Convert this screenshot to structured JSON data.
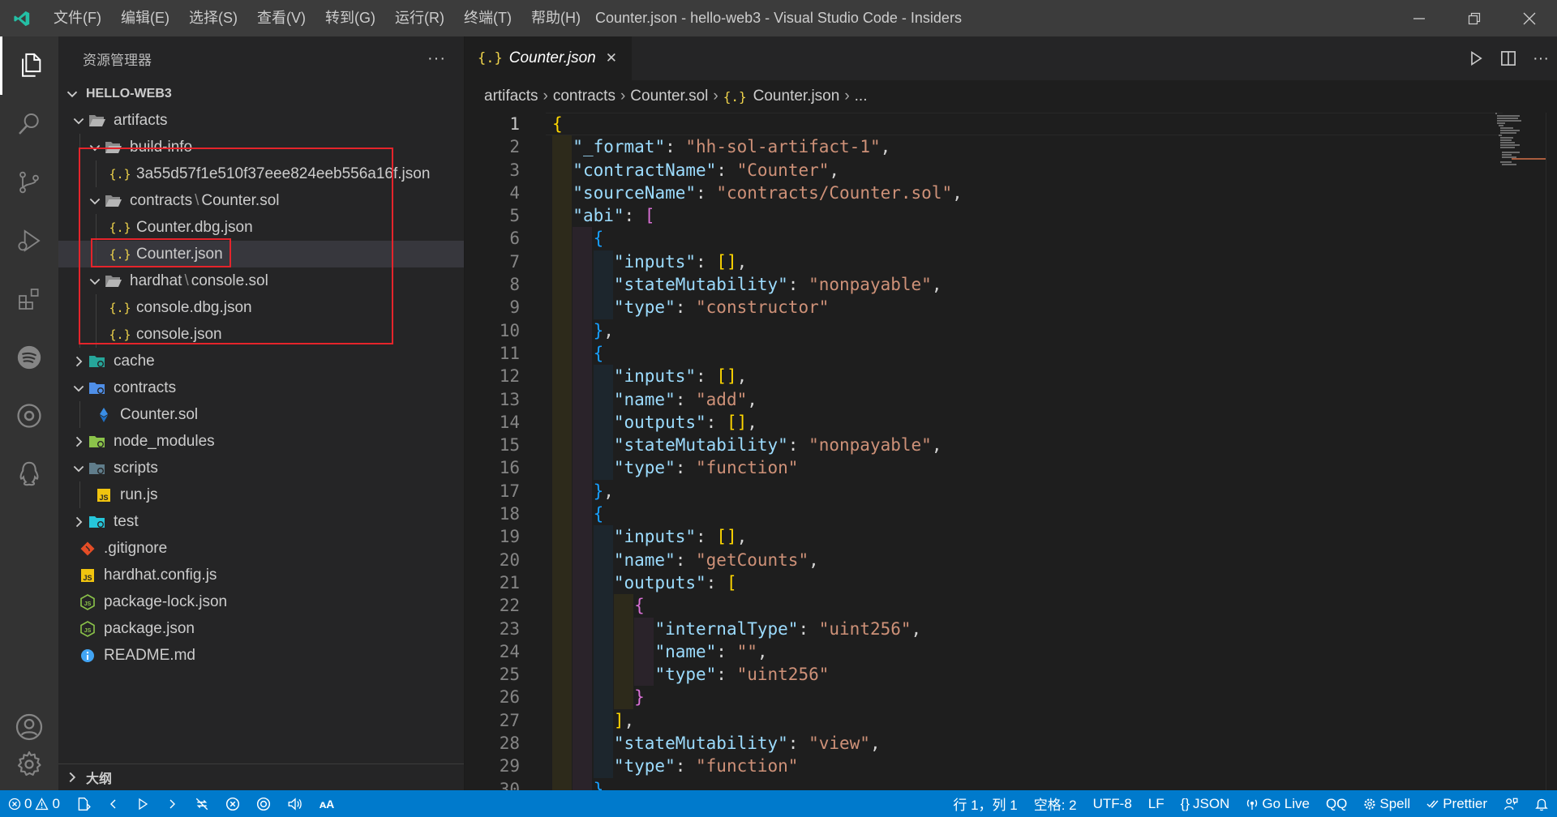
{
  "window": {
    "title": "Counter.json - hello-web3 - Visual Studio Code - Insiders",
    "menu": [
      "文件(F)",
      "编辑(E)",
      "选择(S)",
      "查看(V)",
      "转到(G)",
      "运行(R)",
      "终端(T)",
      "帮助(H)"
    ]
  },
  "activity_bar": {
    "items": [
      "explorer-icon",
      "search-icon",
      "source-control-icon",
      "run-debug-icon",
      "extensions-icon",
      "spotify-icon",
      "target-icon",
      "qq-penguin-icon"
    ],
    "bottom": [
      "account-icon",
      "settings-gear-icon"
    ]
  },
  "sidebar": {
    "title": "资源管理器",
    "more": "···",
    "section": "HELLO-WEB3",
    "outline": "大纲",
    "tree": [
      {
        "label": "artifacts",
        "depth": 0,
        "type": "folder-open",
        "icon": "folder-open-icon",
        "color": "#c09553"
      },
      {
        "label": "build-info",
        "depth": 1,
        "type": "folder-open",
        "icon": "folder-open-icon",
        "color": "#c09553"
      },
      {
        "label": "3a55d57f1e510f37eee824eeb556a16f.json",
        "depth": 2,
        "type": "file",
        "icon": "json-file-icon",
        "color": "#f1d54c"
      },
      {
        "label": "contracts",
        "label2": "Counter.sol",
        "depth": 1,
        "type": "folder-open",
        "icon": "folder-open-icon",
        "color": "#c09553"
      },
      {
        "label": "Counter.dbg.json",
        "depth": 2,
        "type": "file",
        "icon": "json-file-icon",
        "color": "#f1d54c"
      },
      {
        "label": "Counter.json",
        "depth": 2,
        "type": "file",
        "icon": "json-file-icon",
        "color": "#f1d54c",
        "selected": true
      },
      {
        "label": "hardhat",
        "label2": "console.sol",
        "depth": 1,
        "type": "folder-open",
        "icon": "folder-open-icon",
        "color": "#c09553"
      },
      {
        "label": "console.dbg.json",
        "depth": 2,
        "type": "file",
        "icon": "json-file-icon",
        "color": "#f1d54c"
      },
      {
        "label": "console.json",
        "depth": 2,
        "type": "file",
        "icon": "json-file-icon",
        "color": "#f1d54c"
      },
      {
        "label": "cache",
        "depth": 0,
        "type": "folder-closed",
        "icon": "cache-folder-icon",
        "color": "#26a69a"
      },
      {
        "label": "contracts",
        "depth": 0,
        "type": "folder-open",
        "icon": "contracts-folder-icon",
        "color": "#4f8fe8"
      },
      {
        "label": "Counter.sol",
        "depth": 1,
        "type": "file",
        "icon": "solidity-file-icon",
        "color": "#3a8ee6"
      },
      {
        "label": "node_modules",
        "depth": 0,
        "type": "folder-closed",
        "icon": "node-modules-folder-icon",
        "color": "#8bc34a"
      },
      {
        "label": "scripts",
        "depth": 0,
        "type": "folder-open",
        "icon": "scripts-folder-icon",
        "color": "#607d8b"
      },
      {
        "label": "run.js",
        "depth": 1,
        "type": "file",
        "icon": "js-file-icon",
        "color": "#f1c40f"
      },
      {
        "label": "test",
        "depth": 0,
        "type": "folder-closed",
        "icon": "test-folder-icon",
        "color": "#26c6da"
      },
      {
        "label": ".gitignore",
        "depth": 0,
        "type": "file",
        "icon": "git-icon",
        "color": "#e44d26"
      },
      {
        "label": "hardhat.config.js",
        "depth": 0,
        "type": "file",
        "icon": "js-file-icon",
        "color": "#f1c40f"
      },
      {
        "label": "package-lock.json",
        "depth": 0,
        "type": "file",
        "icon": "node-package-icon",
        "color": "#8bc34a"
      },
      {
        "label": "package.json",
        "depth": 0,
        "type": "file",
        "icon": "node-package-icon",
        "color": "#8bc34a"
      },
      {
        "label": "README.md",
        "depth": 0,
        "type": "file",
        "icon": "info-icon",
        "color": "#42a5f5"
      }
    ]
  },
  "editor": {
    "tab": {
      "label": "Counter.json",
      "close": "✕"
    },
    "breadcrumbs": [
      "artifacts",
      "contracts",
      "Counter.sol",
      "Counter.json",
      "..."
    ],
    "current_line": 1,
    "lines": [
      [
        [
          "{",
          "b1"
        ]
      ],
      [
        [
          "  ",
          ""
        ],
        [
          "\"_format\"",
          "k"
        ],
        [
          ": ",
          "p"
        ],
        [
          "\"hh-sol-artifact-1\"",
          "s"
        ],
        [
          ",",
          "p"
        ]
      ],
      [
        [
          "  ",
          ""
        ],
        [
          "\"contractName\"",
          "k"
        ],
        [
          ": ",
          "p"
        ],
        [
          "\"Counter\"",
          "s"
        ],
        [
          ",",
          "p"
        ]
      ],
      [
        [
          "  ",
          ""
        ],
        [
          "\"sourceName\"",
          "k"
        ],
        [
          ": ",
          "p"
        ],
        [
          "\"contracts/Counter.sol\"",
          "s"
        ],
        [
          ",",
          "p"
        ]
      ],
      [
        [
          "  ",
          ""
        ],
        [
          "\"abi\"",
          "k"
        ],
        [
          ": ",
          "p"
        ],
        [
          "[",
          "b2"
        ]
      ],
      [
        [
          "    ",
          ""
        ],
        [
          "{",
          "b3"
        ]
      ],
      [
        [
          "      ",
          ""
        ],
        [
          "\"inputs\"",
          "k"
        ],
        [
          ": ",
          "p"
        ],
        [
          "[]",
          "b1"
        ],
        [
          ",",
          "p"
        ]
      ],
      [
        [
          "      ",
          ""
        ],
        [
          "\"stateMutability\"",
          "k"
        ],
        [
          ": ",
          "p"
        ],
        [
          "\"nonpayable\"",
          "s"
        ],
        [
          ",",
          "p"
        ]
      ],
      [
        [
          "      ",
          ""
        ],
        [
          "\"type\"",
          "k"
        ],
        [
          ": ",
          "p"
        ],
        [
          "\"constructor\"",
          "s"
        ]
      ],
      [
        [
          "    ",
          ""
        ],
        [
          "}",
          "b3"
        ],
        [
          ",",
          "p"
        ]
      ],
      [
        [
          "    ",
          ""
        ],
        [
          "{",
          "b3"
        ]
      ],
      [
        [
          "      ",
          ""
        ],
        [
          "\"inputs\"",
          "k"
        ],
        [
          ": ",
          "p"
        ],
        [
          "[]",
          "b1"
        ],
        [
          ",",
          "p"
        ]
      ],
      [
        [
          "      ",
          ""
        ],
        [
          "\"name\"",
          "k"
        ],
        [
          ": ",
          "p"
        ],
        [
          "\"add\"",
          "s"
        ],
        [
          ",",
          "p"
        ]
      ],
      [
        [
          "      ",
          ""
        ],
        [
          "\"outputs\"",
          "k"
        ],
        [
          ": ",
          "p"
        ],
        [
          "[]",
          "b1"
        ],
        [
          ",",
          "p"
        ]
      ],
      [
        [
          "      ",
          ""
        ],
        [
          "\"stateMutability\"",
          "k"
        ],
        [
          ": ",
          "p"
        ],
        [
          "\"nonpayable\"",
          "s"
        ],
        [
          ",",
          "p"
        ]
      ],
      [
        [
          "      ",
          ""
        ],
        [
          "\"type\"",
          "k"
        ],
        [
          ": ",
          "p"
        ],
        [
          "\"function\"",
          "s"
        ]
      ],
      [
        [
          "    ",
          ""
        ],
        [
          "}",
          "b3"
        ],
        [
          ",",
          "p"
        ]
      ],
      [
        [
          "    ",
          ""
        ],
        [
          "{",
          "b3"
        ]
      ],
      [
        [
          "      ",
          ""
        ],
        [
          "\"inputs\"",
          "k"
        ],
        [
          ": ",
          "p"
        ],
        [
          "[]",
          "b1"
        ],
        [
          ",",
          "p"
        ]
      ],
      [
        [
          "      ",
          ""
        ],
        [
          "\"name\"",
          "k"
        ],
        [
          ": ",
          "p"
        ],
        [
          "\"getCounts\"",
          "s"
        ],
        [
          ",",
          "p"
        ]
      ],
      [
        [
          "      ",
          ""
        ],
        [
          "\"outputs\"",
          "k"
        ],
        [
          ": ",
          "p"
        ],
        [
          "[",
          "b1"
        ]
      ],
      [
        [
          "        ",
          ""
        ],
        [
          "{",
          "b2"
        ]
      ],
      [
        [
          "          ",
          ""
        ],
        [
          "\"internalType\"",
          "k"
        ],
        [
          ": ",
          "p"
        ],
        [
          "\"uint256\"",
          "s"
        ],
        [
          ",",
          "p"
        ]
      ],
      [
        [
          "          ",
          ""
        ],
        [
          "\"name\"",
          "k"
        ],
        [
          ": ",
          "p"
        ],
        [
          "\"\"",
          "s"
        ],
        [
          ",",
          "p"
        ]
      ],
      [
        [
          "          ",
          ""
        ],
        [
          "\"type\"",
          "k"
        ],
        [
          ": ",
          "p"
        ],
        [
          "\"uint256\"",
          "s"
        ]
      ],
      [
        [
          "        ",
          ""
        ],
        [
          "}",
          "b2"
        ]
      ],
      [
        [
          "      ",
          ""
        ],
        [
          "]",
          "b1"
        ],
        [
          ",",
          "p"
        ]
      ],
      [
        [
          "      ",
          ""
        ],
        [
          "\"stateMutability\"",
          "k"
        ],
        [
          ": ",
          "p"
        ],
        [
          "\"view\"",
          "s"
        ],
        [
          ",",
          "p"
        ]
      ],
      [
        [
          "      ",
          ""
        ],
        [
          "\"type\"",
          "k"
        ],
        [
          ": ",
          "p"
        ],
        [
          "\"function\"",
          "s"
        ]
      ],
      [
        [
          "    ",
          ""
        ],
        [
          "}",
          "b3"
        ]
      ]
    ]
  },
  "status_bar": {
    "errors": "0",
    "warnings": "0",
    "cursor": "行 1，列 1",
    "indent": "空格: 2",
    "encoding": "UTF-8",
    "eol": "LF",
    "language": "JSON",
    "go_live": "Go Live",
    "qq": "QQ",
    "spell": "Spell",
    "prettier": "Prettier"
  },
  "colors": {
    "accent": "#007acc",
    "highlight_box": "#e5242b",
    "json_key": "#9cdcfe",
    "json_string": "#ce9178"
  }
}
